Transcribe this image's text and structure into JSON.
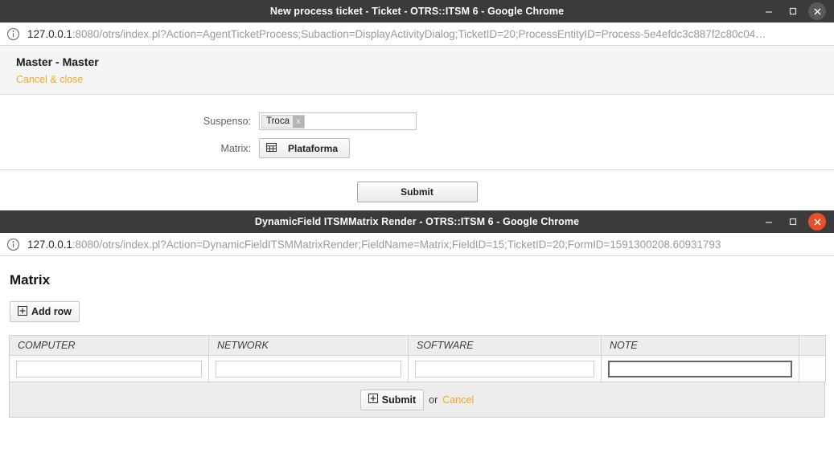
{
  "window1": {
    "title": "New process ticket - Ticket - OTRS::ITSM 6 - Google Chrome",
    "url_host": "127.0.0.1",
    "url_rest": ":8080/otrs/index.pl?Action=AgentTicketProcess;Subaction=DisplayActivityDialog;TicketID=20;ProcessEntityID=Process-5e4efdc3c887f2c80c04…",
    "activity_title": "Master - Master",
    "cancel_label": "Cancel & close",
    "fields": {
      "suspenso_label": "Suspenso:",
      "suspenso_token": "Troca",
      "suspenso_token_remove": "x",
      "matrix_label": "Matrix:",
      "matrix_button_label": "Plataforma"
    },
    "submit_label": "Submit",
    "controls": {
      "minimize": "minimize-button",
      "maximize": "maximize-button",
      "close": "close-button"
    }
  },
  "window2": {
    "title": "DynamicField ITSMMatrix Render - OTRS::ITSM 6 - Google Chrome",
    "url_host": "127.0.0.1",
    "url_rest": ":8080/otrs/index.pl?Action=DynamicFieldITSMMatrixRender;FieldName=Matrix;FieldID=15;TicketID=20;FormID=1591300208.60931793",
    "page_title": "Matrix",
    "add_row_label": "Add row",
    "table": {
      "headers": [
        "COMPUTER",
        "NETWORK",
        "SOFTWARE",
        "NOTE",
        ""
      ],
      "rows": [
        {
          "computer": "",
          "network": "",
          "software": "",
          "note": "",
          "extra": ""
        }
      ]
    },
    "footer": {
      "submit_label": "Submit",
      "or_label": "or",
      "cancel_label": "Cancel"
    }
  },
  "colors": {
    "titlebar_bg": "#3b3b3b",
    "accent_orange": "#f5a623",
    "close_active": "#e8502b",
    "url_host_text": "#2b2b2b",
    "url_rest_text": "#9a9a9a"
  }
}
